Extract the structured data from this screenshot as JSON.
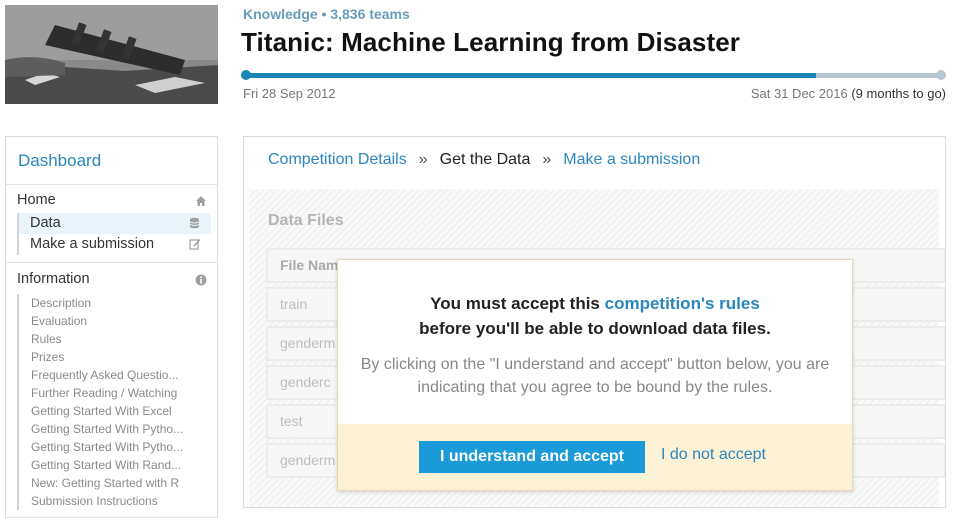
{
  "header": {
    "kicker": "Knowledge • 3,836 teams",
    "title": "Titanic: Machine Learning from Disaster",
    "start_date": "Fri 28 Sep 2012",
    "end_date": "Sat 31 Dec 2016",
    "remaining": "(9 months to go)",
    "progress": 0.82,
    "progress_color": "#1a86b8"
  },
  "sidebar": {
    "dashboard": "Dashboard",
    "home": "Home",
    "home_icon": "home-icon",
    "data": "Data",
    "data_icon": "database-icon",
    "submission": "Make a submission",
    "submission_icon": "edit-icon",
    "information": "Information",
    "information_icon": "info-icon",
    "info_items": [
      "Description",
      "Evaluation",
      "Rules",
      "Prizes",
      "Frequently Asked Questio...",
      "Further Reading / Watching",
      "Getting Started With Excel",
      "Getting Started With Pytho...",
      "Getting Started With Pytho...",
      "Getting Started With Rand...",
      "New: Getting Started with R",
      "Submission Instructions"
    ]
  },
  "breadcrumb": {
    "details": "Competition Details",
    "sep": "»",
    "current": "Get the Data",
    "submission": "Make a submission"
  },
  "data_files": {
    "heading": "Data Files",
    "col_header": "File Name",
    "rows": [
      "train",
      "genderm",
      "genderc",
      "test",
      "genderm"
    ]
  },
  "modal": {
    "line1_pre": "You must accept this ",
    "line1_link": "competition's rules",
    "line2": "before you'll be able to download data files.",
    "body": "By clicking on the \"I understand and accept\" button below, you are indicating that you agree to be bound by the rules.",
    "accept_label": "I understand and accept",
    "decline_label": "I do not accept"
  }
}
